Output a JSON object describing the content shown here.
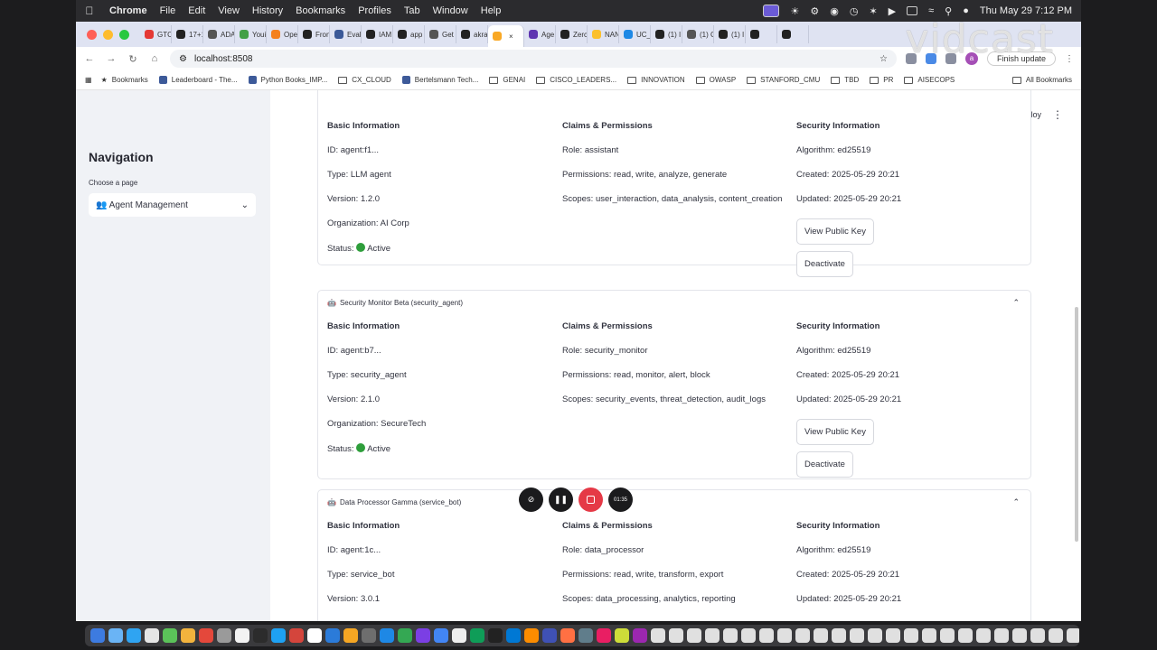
{
  "menubar": {
    "app": "Chrome",
    "items": [
      "File",
      "Edit",
      "View",
      "History",
      "Bookmarks",
      "Profiles",
      "Tab",
      "Window",
      "Help"
    ],
    "clock": "Thu May 29  7:12 PM"
  },
  "tabs": [
    {
      "label": "GTC",
      "color": "#e53935"
    },
    {
      "label": "17+1",
      "color": "#222222"
    },
    {
      "label": "ADA",
      "color": "#555555"
    },
    {
      "label": "Youi",
      "color": "#43a047"
    },
    {
      "label": "Ope",
      "color": "#f4811f"
    },
    {
      "label": "Fron",
      "color": "#222222"
    },
    {
      "label": "Eval",
      "color": "#3b5998"
    },
    {
      "label": "IAM",
      "color": "#222222"
    },
    {
      "label": "app",
      "color": "#222222"
    },
    {
      "label": "Get",
      "color": "#555555"
    },
    {
      "label": "akra",
      "color": "#222222"
    },
    {
      "label": "",
      "color": "#f9a825",
      "active": true
    },
    {
      "label": "Age",
      "color": "#5e35b1"
    },
    {
      "label": "Zerc",
      "color": "#222222"
    },
    {
      "label": "NAN",
      "color": "#fbc02d"
    },
    {
      "label": "UC_",
      "color": "#1e88e5"
    },
    {
      "label": "(1) I",
      "color": "#222222"
    },
    {
      "label": "(1) C",
      "color": "#555555"
    },
    {
      "label": "(1) I",
      "color": "#222222"
    },
    {
      "label": "",
      "color": "#222222"
    },
    {
      "label": "",
      "color": "#222222"
    }
  ],
  "watermark": "vidcast",
  "toolbar": {
    "url": "localhost:8508",
    "finish_update": "Finish update",
    "avatar_letter": "a"
  },
  "bookmarks": [
    {
      "label": "Bookmarks",
      "icon": "star-icon"
    },
    {
      "label": "Leaderboard - The...",
      "icon": "site-icon"
    },
    {
      "label": "Python Books_IMP...",
      "icon": "site-icon"
    },
    {
      "label": "CX_CLOUD",
      "icon": "folder-icon"
    },
    {
      "label": "Bertelsmann Tech...",
      "icon": "site-icon"
    },
    {
      "label": "GENAI",
      "icon": "folder-icon"
    },
    {
      "label": "CISCO_LEADERS...",
      "icon": "folder-icon"
    },
    {
      "label": "INNOVATION",
      "icon": "folder-icon"
    },
    {
      "label": "OWASP",
      "icon": "folder-icon"
    },
    {
      "label": "STANFORD_CMU",
      "icon": "folder-icon"
    },
    {
      "label": "TBD",
      "icon": "folder-icon"
    },
    {
      "label": "PR",
      "icon": "folder-icon"
    },
    {
      "label": "AISECOPS",
      "icon": "folder-icon"
    }
  ],
  "all_bookmarks": "All Bookmarks",
  "sidebar": {
    "title": "Navigation",
    "choose_label": "Choose a page",
    "selected_page": "👥 Agent Management"
  },
  "header": {
    "deploy": "Deploy"
  },
  "cards": [
    {
      "title": "",
      "basic_header": "Basic Information",
      "claims_header": "Claims & Permissions",
      "security_header": "Security Information",
      "basic": [
        "ID: agent:f1...",
        "Type: LLM agent",
        "Version: 1.2.0",
        "Organization: AI Corp"
      ],
      "status": "Status: ",
      "status_value": "Active",
      "claims": [
        "Role: assistant",
        "Permissions: read, write, analyze, generate",
        "Scopes: user_interaction, data_analysis, content_creation"
      ],
      "security": [
        "Algorithm: ed25519",
        "Created: 2025-05-29 20:21",
        "Updated: 2025-05-29 20:21"
      ],
      "view_key": "View Public Key",
      "deactivate": "Deactivate"
    },
    {
      "title": "Security Monitor Beta (security_agent)",
      "basic_header": "Basic Information",
      "claims_header": "Claims & Permissions",
      "security_header": "Security Information",
      "basic": [
        "ID: agent:b7...",
        "Type: security_agent",
        "Version: 2.1.0",
        "Organization: SecureTech"
      ],
      "status": "Status: ",
      "status_value": "Active",
      "claims": [
        "Role: security_monitor",
        "Permissions: read, monitor, alert, block",
        "Scopes: security_events, threat_detection, audit_logs"
      ],
      "security": [
        "Algorithm: ed25519",
        "Created: 2025-05-29 20:21",
        "Updated: 2025-05-29 20:21"
      ],
      "view_key": "View Public Key",
      "deactivate": "Deactivate"
    },
    {
      "title": "Data Processor Gamma (service_bot)",
      "basic_header": "Basic Information",
      "claims_header": "Claims & Permissions",
      "security_header": "Security Information",
      "basic": [
        "ID: agent:1c...",
        "Type: service_bot",
        "Version: 3.0.1"
      ],
      "claims": [
        "Role: data_processor",
        "Permissions: read, write, transform, export",
        "Scopes: data_processing, analytics, reporting"
      ],
      "security": [
        "Algorithm: ed25519",
        "Created: 2025-05-29 20:21",
        "Updated: 2025-05-29 20:21"
      ]
    }
  ],
  "recorder": {
    "time": "01:35"
  },
  "colors": {
    "status_green": "#2e9e3b",
    "sidebar_bg": "#f0f2f6",
    "record_red": "#e53946"
  }
}
